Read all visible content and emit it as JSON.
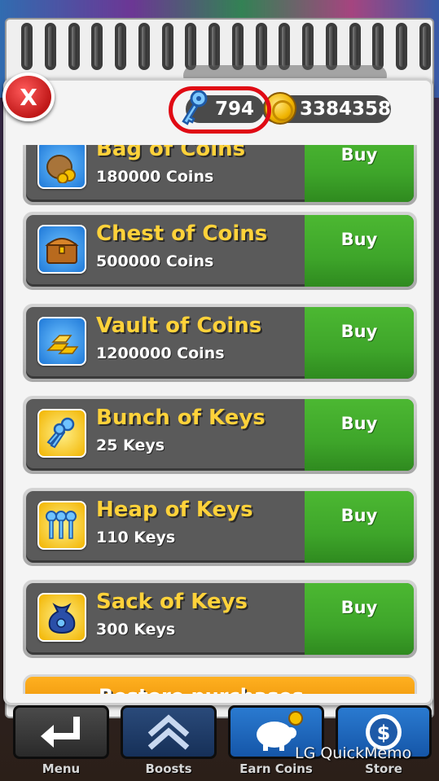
{
  "header": {
    "close_label": "X",
    "keys_count": "794",
    "coins_count": "3384358"
  },
  "items": [
    {
      "title": "Bag of Coins",
      "subtitle": "180000 Coins",
      "button": "Buy",
      "icon": "coin-bag-icon"
    },
    {
      "title": "Chest of Coins",
      "subtitle": "500000 Coins",
      "button": "Buy",
      "icon": "treasure-chest-icon"
    },
    {
      "title": "Vault of Coins",
      "subtitle": "1200000 Coins",
      "button": "Buy",
      "icon": "gold-bars-icon"
    },
    {
      "title": "Bunch of Keys",
      "subtitle": "25 Keys",
      "button": "Buy",
      "icon": "keys-bunch-icon"
    },
    {
      "title": "Heap of Keys",
      "subtitle": "110 Keys",
      "button": "Buy",
      "icon": "keys-heap-icon"
    },
    {
      "title": "Sack of Keys",
      "subtitle": "300 Keys",
      "button": "Buy",
      "icon": "keys-sack-icon"
    }
  ],
  "restore": {
    "label": "Restore purchases"
  },
  "nav": {
    "menu": "Menu",
    "boosts": "Boosts",
    "earn": "Earn Coins",
    "store": "Store"
  },
  "watermark": "LG QuickMemo",
  "colors": {
    "buy_green": "#3ea52a",
    "title_yellow": "#ffd23a",
    "highlight_red": "#e00a14",
    "restore_orange": "#f29a00"
  }
}
